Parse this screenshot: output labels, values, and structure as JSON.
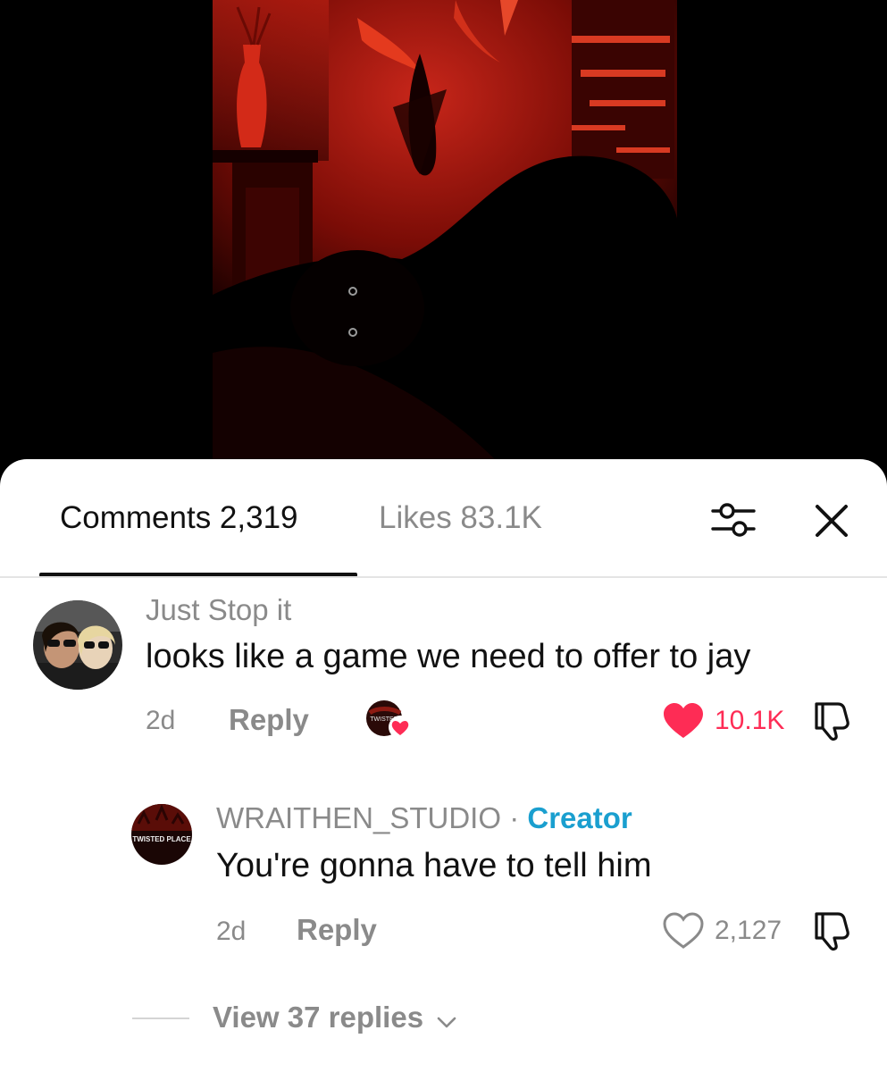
{
  "video": {
    "scene": "dark red-lit room video frame"
  },
  "sheet": {
    "tabs": {
      "comments_label": "Comments 2,319",
      "likes_label": "Likes 83.1K"
    },
    "icons": {
      "filter": "filter-sliders-icon",
      "close": "close-icon"
    }
  },
  "comments": [
    {
      "username": "Just Stop it",
      "text": "looks like a game we need to offer to jay",
      "time": "2d",
      "reply_label": "Reply",
      "likes": "10.1K",
      "liked": true,
      "creator_liked": true,
      "creator_badge_text": "TWISTED"
    },
    {
      "username": "WRAITHEN_STUDIO",
      "separator": "·",
      "role": "Creator",
      "avatar_text": "TWISTED PLACE",
      "text": "You're gonna have to tell him",
      "time": "2d",
      "reply_label": "Reply",
      "likes": "2,127",
      "liked": false
    }
  ],
  "view_replies": {
    "label": "View 37 replies"
  },
  "colors": {
    "like_active": "#fe2c55",
    "creator": "#1a9fcf",
    "muted": "#8a8a8a",
    "video_red": "#c21a10"
  }
}
